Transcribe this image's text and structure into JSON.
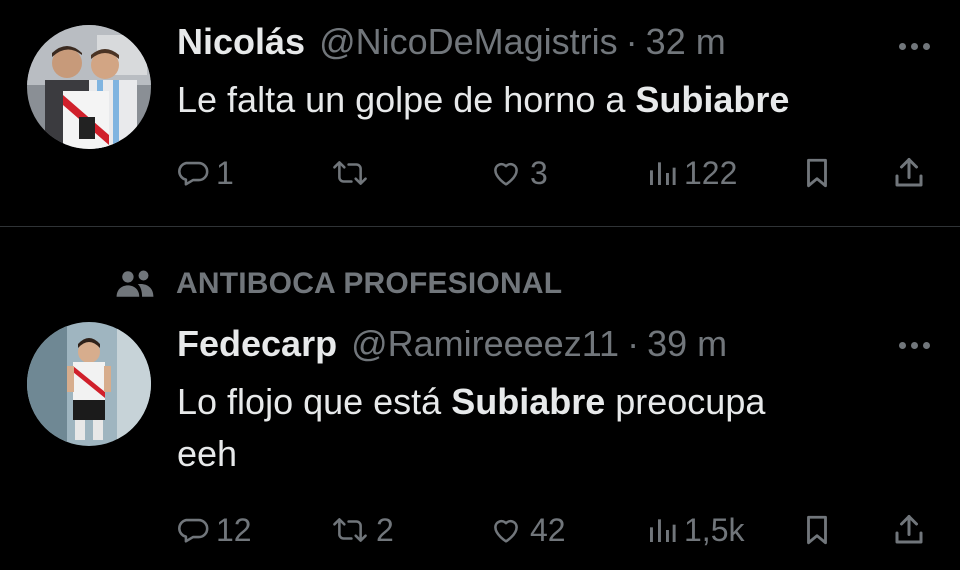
{
  "tweets": [
    {
      "author_name": "Nicolás",
      "handle": "@NicoDeMagistris",
      "time": "32 m",
      "text_parts": [
        "Le falta un golpe de horno a ",
        "Subiabre"
      ],
      "stats": {
        "replies": "1",
        "retweets": "",
        "likes": "3",
        "views": "122"
      },
      "avatar_icon": "avatar-photo-two-men-with-jersey"
    },
    {
      "social_context": "ANTIBOCA PROFESIONAL",
      "author_name": "Fedecarp",
      "handle": "@Ramireeeez11",
      "time": "39 m",
      "text_parts": [
        "Lo flojo que está ",
        "Subiabre",
        " preocupa",
        "eeh"
      ],
      "stats": {
        "replies": "12",
        "retweets": "2",
        "likes": "42",
        "views": "1,5k"
      },
      "avatar_icon": "avatar-photo-player-river-kit"
    }
  ],
  "colors": {
    "background": "#000000",
    "primary_text": "#e7e9ea",
    "secondary_text": "#71767b",
    "divider": "#2f3336"
  },
  "icons": [
    "reply-icon",
    "retweet-icon",
    "like-icon",
    "views-icon",
    "bookmark-icon",
    "share-icon",
    "more-icon",
    "community-icon"
  ]
}
